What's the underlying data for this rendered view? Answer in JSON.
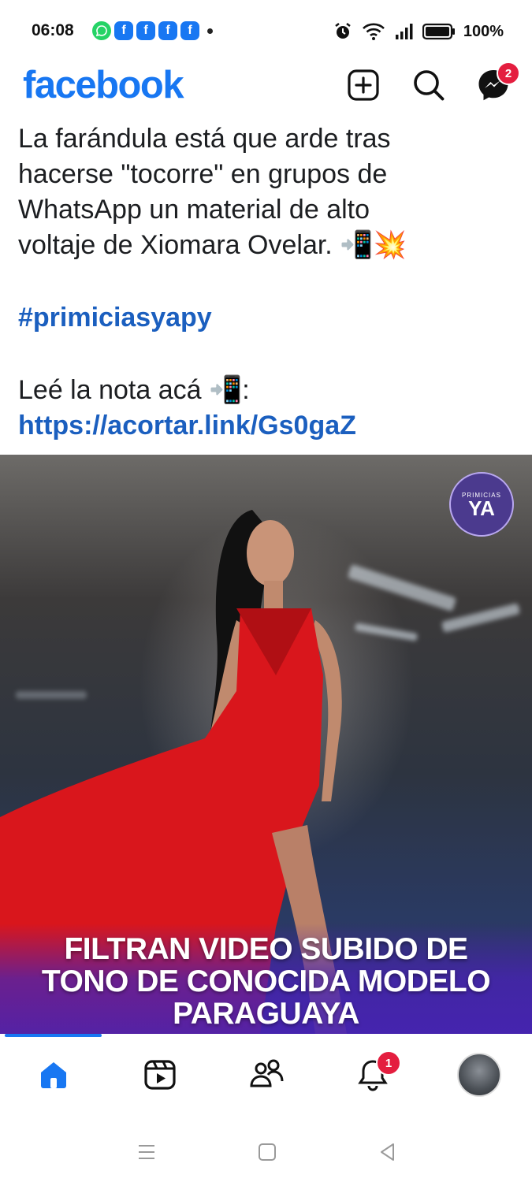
{
  "status_bar": {
    "time": "06:08",
    "notification_icons": [
      "whatsapp-icon",
      "facebook-icon",
      "facebook-icon",
      "facebook-icon",
      "facebook-icon"
    ],
    "system_icons": [
      "alarm-icon",
      "wifi-icon",
      "signal-icon",
      "battery-icon"
    ],
    "battery": "100%"
  },
  "header": {
    "logo": "facebook",
    "messenger_badge": "2"
  },
  "post": {
    "text_lines": [
      "La farándula está que arde tras",
      "hacerse \"tocorre\" en grupos de",
      "WhatsApp un material de alto",
      "voltaje de Xiomara Ovelar. 📲💥"
    ],
    "hashtag": "#primiciasyapy",
    "read_note": "Leé la nota acá 📲:",
    "link": "https://acortar.link/Gs0gaZ"
  },
  "image": {
    "watermark_small": "PRIMICIAS",
    "watermark_big": "YA",
    "headline_lines": [
      "FILTRAN VIDEO SUBIDO DE",
      "TONO DE CONOCIDA MODELO",
      "PARAGUAYA"
    ]
  },
  "bottom_nav": {
    "items": [
      "home-icon",
      "video-icon",
      "friends-icon",
      "notifications-icon",
      "profile-avatar"
    ],
    "notifications_badge": "1",
    "active": "home-icon"
  },
  "colors": {
    "brand": "#1877f2",
    "link": "#1b5fbf",
    "badge": "#e41e3f",
    "headline_overlay": "#4623b4"
  }
}
